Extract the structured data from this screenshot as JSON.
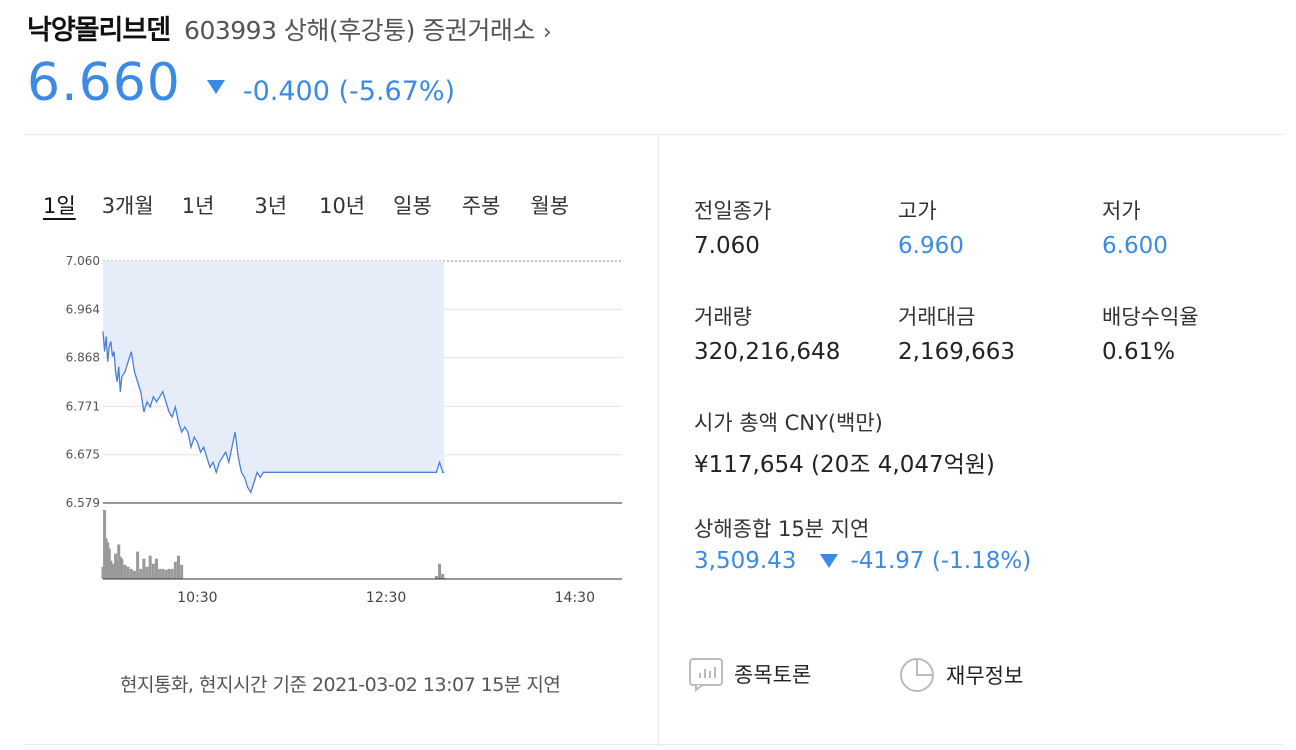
{
  "header": {
    "stock_name": "낙양몰리브덴",
    "stock_meta": "603993 상해(후강퉁) 증권거래소",
    "chevron_icon": "chevron-right-icon",
    "price": "6.660",
    "change": "-0.400 (-5.67%)",
    "direction_icon": "down-triangle-icon",
    "accent_color": "#3a8ae6"
  },
  "tabs": [
    "1일",
    "3개월",
    "1년",
    "3년",
    "10년",
    "일봉",
    "주봉",
    "월봉"
  ],
  "active_tab": "1일",
  "chart_data": {
    "type": "line",
    "y_ticks": [
      "7.060",
      "6.964",
      "6.868",
      "6.771",
      "6.675",
      "6.579"
    ],
    "ylim": [
      6.579,
      7.06
    ],
    "x_ticks": [
      "10:30",
      "12:30",
      "14:30"
    ],
    "x_range": [
      "09:30",
      "15:00"
    ],
    "previous_close": 7.06,
    "series": [
      {
        "x": [
          "09:30",
          "09:31",
          "09:32",
          "09:33",
          "09:34",
          "09:35",
          "09:36",
          "09:37",
          "09:38",
          "09:39",
          "09:40",
          "09:41",
          "09:42",
          "09:44",
          "09:46",
          "09:48",
          "09:50",
          "09:52",
          "09:54",
          "09:56",
          "09:58",
          "10:00",
          "10:02",
          "10:04",
          "10:06",
          "10:08",
          "10:10",
          "10:12",
          "10:14",
          "10:16",
          "10:18",
          "10:20",
          "10:22",
          "10:24",
          "10:26",
          "10:28",
          "10:30",
          "10:32",
          "10:34",
          "10:36",
          "10:38",
          "10:40",
          "10:42",
          "10:44",
          "10:46",
          "10:48",
          "10:50",
          "10:52",
          "10:54",
          "10:56",
          "10:58",
          "11:00",
          "11:02",
          "11:04",
          "11:06",
          "11:08",
          "11:10",
          "11:12",
          "11:14",
          "11:16",
          "11:18",
          "11:20",
          "11:22",
          "11:24",
          "11:26",
          "11:28",
          "11:30",
          "13:00",
          "13:02",
          "13:04",
          "13:06",
          "13:07"
        ],
        "y": [
          6.92,
          6.88,
          6.91,
          6.86,
          6.89,
          6.9,
          6.87,
          6.88,
          6.84,
          6.82,
          6.85,
          6.8,
          6.83,
          6.84,
          6.86,
          6.88,
          6.84,
          6.82,
          6.8,
          6.76,
          6.78,
          6.77,
          6.79,
          6.78,
          6.79,
          6.8,
          6.78,
          6.76,
          6.75,
          6.77,
          6.74,
          6.72,
          6.73,
          6.72,
          6.69,
          6.71,
          6.7,
          6.68,
          6.69,
          6.67,
          6.65,
          6.66,
          6.64,
          6.66,
          6.67,
          6.68,
          6.66,
          6.69,
          6.72,
          6.67,
          6.64,
          6.63,
          6.61,
          6.6,
          6.62,
          6.64,
          6.63,
          6.64,
          6.64,
          6.64,
          6.64,
          6.64,
          6.64,
          6.64,
          6.64,
          6.64,
          6.64,
          6.64,
          6.64,
          6.66,
          6.64,
          6.64
        ]
      }
    ],
    "volume": [
      12,
      68,
      40,
      36,
      30,
      18,
      15,
      14,
      25,
      18,
      34,
      22,
      20,
      14,
      12,
      10,
      8,
      27,
      10,
      20,
      12,
      23,
      15,
      20,
      10,
      10,
      9,
      10,
      10,
      17,
      23,
      14,
      0,
      0,
      0,
      0,
      0,
      0,
      0,
      0,
      0,
      0,
      0,
      0,
      0,
      0,
      0,
      0,
      0,
      0,
      0,
      0,
      0,
      0,
      0,
      0,
      0,
      0,
      0,
      0,
      0,
      0,
      0,
      0,
      0,
      0,
      0,
      0,
      3,
      15,
      5,
      1
    ]
  },
  "footnote": "현지통화, 현지시간 기준 2021-03-02 13:07 15분 지연",
  "stats": [
    {
      "label": "전일종가",
      "value": "7.060",
      "color": "#222222"
    },
    {
      "label": "고가",
      "value": "6.960",
      "color": "#3a8ae6"
    },
    {
      "label": "저가",
      "value": "6.600",
      "color": "#3a8ae6"
    },
    {
      "label": "거래량",
      "value": "320,216,648",
      "color": "#222222"
    },
    {
      "label": "거래대금",
      "value": "2,169,663",
      "color": "#222222"
    },
    {
      "label": "배당수익율",
      "value": "0.61%",
      "color": "#222222"
    }
  ],
  "market_cap": {
    "label": "시가 총액 CNY(백만)",
    "value": "¥117,654 (20조 4,047억원)"
  },
  "index": {
    "label": "상해종합 15분 지연",
    "value": "3,509.43",
    "change": "-41.97 (-1.18%)",
    "direction_icon": "down-triangle-icon"
  },
  "buttons": [
    {
      "label": "종목토론",
      "icon": "discussion-chart-icon"
    },
    {
      "label": "재무정보",
      "icon": "pie-chart-icon"
    }
  ]
}
